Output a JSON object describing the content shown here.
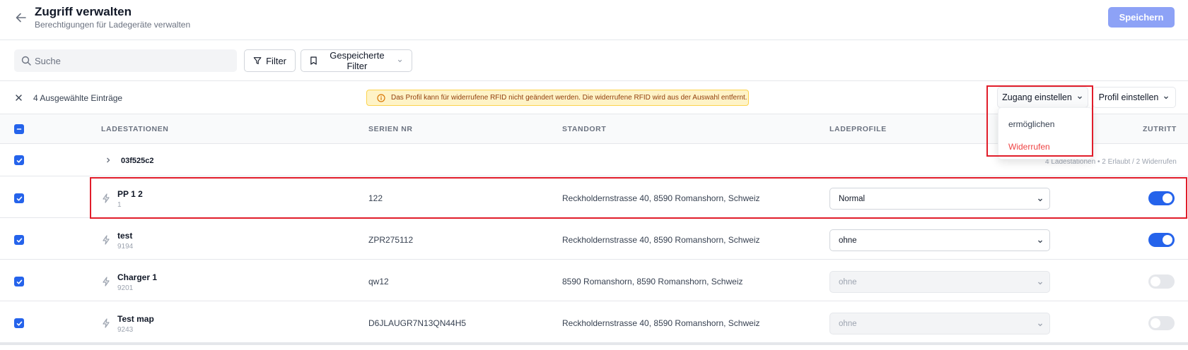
{
  "header": {
    "title": "Zugriff verwalten",
    "subtitle": "Berechtigungen für Ladegeräte verwalten",
    "save_label": "Speichern"
  },
  "toolbar": {
    "search_placeholder": "Suche",
    "filter_label": "Filter",
    "saved_filter_label": "Gespeicherte Filter"
  },
  "selection": {
    "count_label": "4 Ausgewählte Einträge",
    "warning": "Das Profil kann für widerrufene RFID nicht geändert werden. Die widerrufene RFID wird aus der Auswahl entfernt.",
    "access_button": "Zugang einstellen",
    "profile_button": "Profil einstellen"
  },
  "access_menu": {
    "items": [
      "ermöglichen",
      "Widerrufen"
    ]
  },
  "table": {
    "columns": [
      "LADESTATIONEN",
      "SERIEN NR",
      "STANDORT",
      "LADEPROFILE",
      "ZUTRITT"
    ],
    "group": {
      "name": "03f525c2",
      "summary": "4 Ladestationen • 2 Erlaubt / 2 Widerrufen"
    },
    "rows": [
      {
        "name": "PP 1 2",
        "id": "1",
        "serial": "122",
        "location": "Reckholdernstrasse 40, 8590 Romanshorn, Schweiz",
        "profile": "Normal",
        "profile_disabled": false,
        "access": true
      },
      {
        "name": "test",
        "id": "9194",
        "serial": "ZPR275112",
        "location": "Reckholdernstrasse 40, 8590 Romanshorn, Schweiz",
        "profile": "ohne",
        "profile_disabled": false,
        "access": true
      },
      {
        "name": "Charger 1",
        "id": "9201",
        "serial": "qw12",
        "location": "8590 Romanshorn, 8590 Romanshorn, Schweiz",
        "profile": "ohne",
        "profile_disabled": true,
        "access": false
      },
      {
        "name": "Test map",
        "id": "9243",
        "serial": "D6JLAUGR7N13QN44H5",
        "location": "Reckholdernstrasse 40, 8590 Romanshorn, Schweiz",
        "profile": "ohne",
        "profile_disabled": true,
        "access": false
      }
    ]
  },
  "colors": {
    "primary": "#2563eb",
    "save_button": "#8da2f6",
    "danger": "#ef4444",
    "warning_bg": "#fef3c7",
    "highlight": "#e11d2a"
  },
  "icons": [
    "arrow-left-icon",
    "search-icon",
    "filter-icon",
    "bookmark-icon",
    "chevron-down-icon",
    "close-icon",
    "info-icon",
    "chevron-right-icon",
    "bolt-icon",
    "check-icon",
    "minus-icon"
  ]
}
